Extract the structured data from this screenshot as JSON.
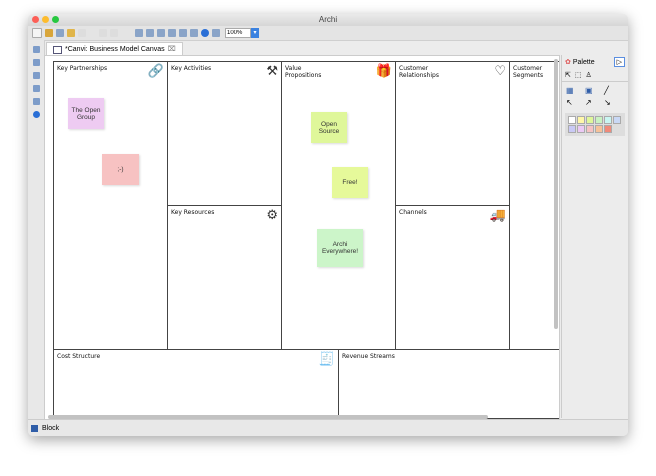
{
  "window": {
    "title": "Archi"
  },
  "toolbar": {
    "zoom": "100%"
  },
  "tab": {
    "label": "*Canvi: Business Model Canvas",
    "close": "⌧"
  },
  "canvas": {
    "cells": {
      "key_partnerships": "Key Partnerships",
      "key_activities": "Key Activities",
      "value_propositions": "Value Propositions",
      "customer_relationships": "Customer Relationships",
      "customer_segments": "Customer Segments",
      "key_resources": "Key Resources",
      "channels": "Channels",
      "cost_structure": "Cost Structure",
      "revenue_streams": "Revenue Streams"
    },
    "notes": [
      {
        "text": "The Open Group",
        "color": "#eecbf2"
      },
      {
        "text": ";-)",
        "color": "#f7c2c2"
      },
      {
        "text": "Open Source",
        "color": "#dff79a"
      },
      {
        "text": "Free!",
        "color": "#e6f99a"
      },
      {
        "text": "Archi Everywhere!",
        "color": "#ccf5c9"
      }
    ]
  },
  "palette": {
    "title": "Palette",
    "swatches": [
      "#ffffff",
      "#fff7a8",
      "#dff79a",
      "#c9f2c2",
      "#c9f5f2",
      "#c9d8f5",
      "#c9c9f5",
      "#ebc9f5",
      "#f5c2c2",
      "#f5c29a",
      "#f08a7a"
    ]
  },
  "status": {
    "text": "Block"
  }
}
